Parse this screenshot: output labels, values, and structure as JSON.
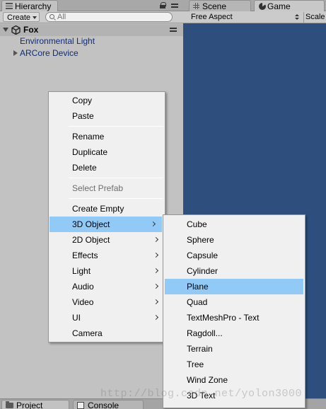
{
  "hierarchy": {
    "tab_label": "Hierarchy",
    "create_label": "Create",
    "search_placeholder": "All",
    "scene_name": "Fox",
    "items": [
      {
        "label": "Environmental Light"
      },
      {
        "label": "ARCore Device"
      }
    ]
  },
  "right_panel": {
    "tabs": [
      {
        "label": "Scene"
      },
      {
        "label": "Game"
      }
    ],
    "aspect_label": "Free Aspect",
    "scale_label": "Scale",
    "background_color": "#2e4f7e"
  },
  "bottom_tabs": [
    {
      "label": "Project"
    },
    {
      "label": "Console"
    }
  ],
  "context_menu": {
    "items": [
      {
        "label": "Copy"
      },
      {
        "label": "Paste"
      },
      {
        "label": "Rename"
      },
      {
        "label": "Duplicate"
      },
      {
        "label": "Delete"
      },
      {
        "label": "Select Prefab",
        "disabled": true
      },
      {
        "label": "Create Empty"
      },
      {
        "label": "3D Object",
        "submenu": true,
        "highlighted": true
      },
      {
        "label": "2D Object",
        "submenu": true
      },
      {
        "label": "Effects",
        "submenu": true
      },
      {
        "label": "Light",
        "submenu": true
      },
      {
        "label": "Audio",
        "submenu": true
      },
      {
        "label": "Video",
        "submenu": true
      },
      {
        "label": "UI",
        "submenu": true
      },
      {
        "label": "Camera"
      }
    ]
  },
  "submenu": {
    "items": [
      {
        "label": "Cube"
      },
      {
        "label": "Sphere"
      },
      {
        "label": "Capsule"
      },
      {
        "label": "Cylinder"
      },
      {
        "label": "Plane",
        "highlighted": true
      },
      {
        "label": "Quad"
      },
      {
        "label": "TextMeshPro - Text"
      },
      {
        "label": "Ragdoll..."
      },
      {
        "label": "Terrain"
      },
      {
        "label": "Tree"
      },
      {
        "label": "Wind Zone"
      },
      {
        "label": "3D Text"
      }
    ]
  },
  "colors": {
    "highlight": "#91c9f7",
    "tree_item_text": "#102c7a",
    "panel_bg": "#c2c2c2"
  },
  "watermark": "http://blog.csdn.net/yolon3000"
}
